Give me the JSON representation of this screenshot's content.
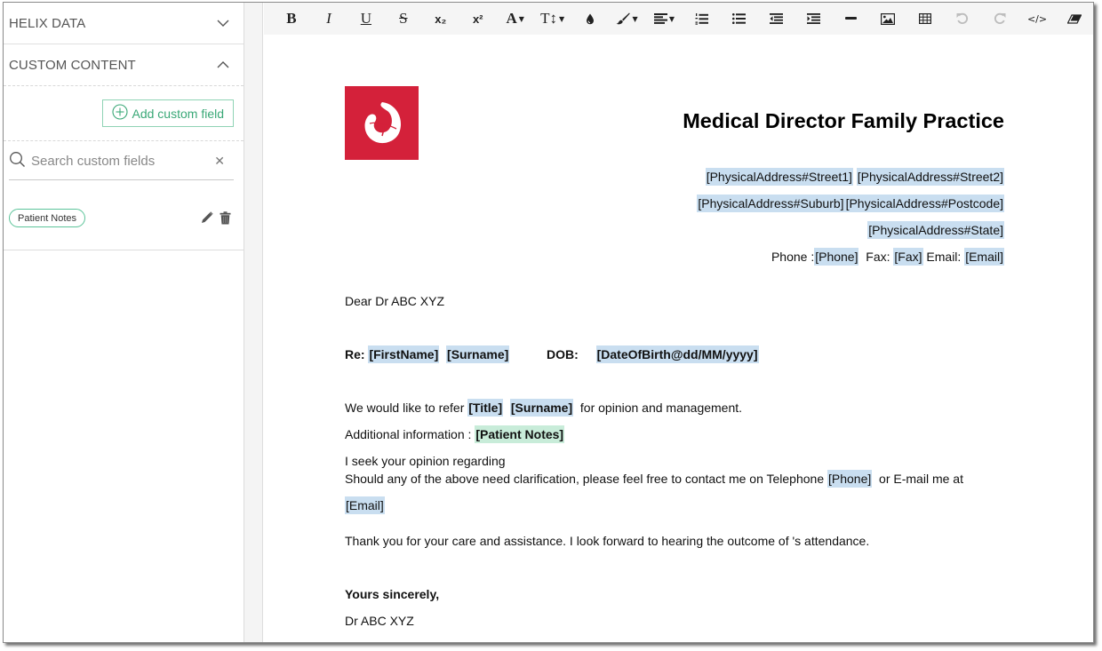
{
  "sidebar": {
    "sections": [
      {
        "label": "HELIX DATA",
        "state": "collapsed",
        "icon": "chevron-down-icon"
      },
      {
        "label": "CUSTOM CONTENT",
        "state": "expanded",
        "icon": "chevron-up-icon"
      }
    ],
    "add_button_label": "Add custom field",
    "search": {
      "placeholder": "Search custom fields",
      "value": ""
    },
    "custom_fields": [
      {
        "label": "Patient Notes",
        "actions": [
          "edit-icon",
          "delete-icon"
        ]
      }
    ]
  },
  "toolbar": {
    "buttons": [
      {
        "name": "bold",
        "glyph": "B"
      },
      {
        "name": "italic",
        "glyph": "I"
      },
      {
        "name": "underline",
        "glyph": "U"
      },
      {
        "name": "strikethrough",
        "glyph": "S"
      },
      {
        "name": "subscript",
        "glyph": "x₂"
      },
      {
        "name": "superscript",
        "glyph": "x²"
      },
      {
        "name": "font-color",
        "glyph": "A"
      },
      {
        "name": "font-size",
        "glyph": "T↕"
      },
      {
        "name": "fill-color"
      },
      {
        "name": "paint-format"
      },
      {
        "name": "align"
      },
      {
        "name": "ordered-list"
      },
      {
        "name": "unordered-list"
      },
      {
        "name": "outdent"
      },
      {
        "name": "indent"
      },
      {
        "name": "horizontal-rule"
      },
      {
        "name": "insert-image"
      },
      {
        "name": "insert-table"
      },
      {
        "name": "undo",
        "disabled": true
      },
      {
        "name": "redo",
        "disabled": true
      },
      {
        "name": "code-view",
        "glyph": "</>"
      },
      {
        "name": "clear-formatting"
      }
    ]
  },
  "colors": {
    "accent_green": "#3aa877",
    "placeholder_bg": "#c9def0",
    "custom_placeholder_bg": "#c8ecd9",
    "logo_red": "#d4213a"
  },
  "document": {
    "practice_name": "Medical Director Family Practice",
    "address": {
      "street1": "[PhysicalAddress#Street1]",
      "street2": "[PhysicalAddress#Street2]",
      "suburb": "[PhysicalAddress#Suburb]",
      "postcode": "[PhysicalAddress#Postcode]",
      "state": "[PhysicalAddress#State]"
    },
    "contact": {
      "phone_label": "Phone :",
      "phone": "[Phone]",
      "fax_label": "Fax:",
      "fax": "[Fax]",
      "email_label": "Email:",
      "email": "[Email]"
    },
    "salutation": "Dear Dr ABC XYZ",
    "re": {
      "label": "Re:",
      "first_name": "[FirstName]",
      "surname": "[Surname]",
      "dob_label": "DOB:",
      "dob": "[DateOfBirth@dd/MM/yyyy]"
    },
    "refer": {
      "prefix": "We would like to refer",
      "title": "[Title]",
      "surname": "[Surname]",
      "suffix": "for opinion and management."
    },
    "additional": {
      "label": "Additional information :",
      "value": "[Patient Notes]"
    },
    "opinion": "I seek your opinion regarding",
    "clarify": {
      "prefix": "Should any of the above need clarification, please feel free to contact me on Telephone",
      "phone": "[Phone]",
      "middle": "or E-mail me at",
      "email": "[Email]"
    },
    "thanks": "Thank you for your care and assistance. I look forward to hearing the outcome of 's attendance.",
    "closing": "Yours sincerely,",
    "signature": "Dr ABC XYZ"
  }
}
